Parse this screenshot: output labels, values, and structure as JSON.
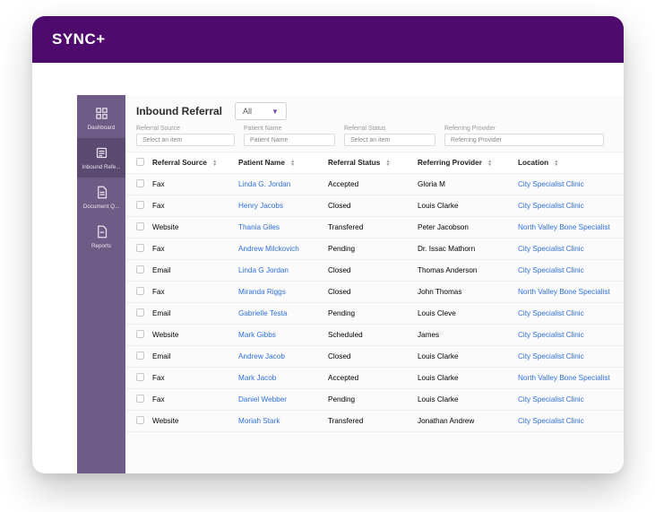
{
  "brand": "SYNC+",
  "sidebar": {
    "items": [
      {
        "label": "Dashboard",
        "icon": "grid",
        "active": false
      },
      {
        "label": "Inbound Refe...",
        "icon": "list",
        "active": true
      },
      {
        "label": "Document Q...",
        "icon": "doc-lines",
        "active": false
      },
      {
        "label": "Reports",
        "icon": "doc",
        "active": false
      }
    ]
  },
  "page": {
    "title": "Inbound Referral",
    "filterSelect": "All"
  },
  "filters": [
    {
      "label": "Referral Source",
      "placeholder": "Select an item"
    },
    {
      "label": "Patient Name",
      "placeholder": "Patient Name"
    },
    {
      "label": "Referral Status",
      "placeholder": "Select an item"
    },
    {
      "label": "Referring Provider",
      "placeholder": "Referring Provider"
    }
  ],
  "columns": [
    "Referral Source",
    "Patient Name",
    "Referral Status",
    "Referring Provider",
    "Location"
  ],
  "rows": [
    {
      "source": "Fax",
      "name": "Linda G. Jordan",
      "status": "Accepted",
      "provider": "Gloria M",
      "location": "City Specialist Clinic"
    },
    {
      "source": "Fax",
      "name": "Henry Jacobs",
      "status": "Closed",
      "provider": "Louis Clarke",
      "location": "City Specialist Clinic"
    },
    {
      "source": "Website",
      "name": "Thania Giles",
      "status": "Transfered",
      "provider": "Peter Jacobson",
      "location": "North Valley Bone Specialist"
    },
    {
      "source": "Fax",
      "name": "Andrew Milckovich",
      "status": "Pending",
      "provider": "Dr. Issac Mathorn",
      "location": "City Specialist Clinic"
    },
    {
      "source": "Email",
      "name": "Linda G Jordan",
      "status": "Closed",
      "provider": "Thomas Anderson",
      "location": "City Specialist Clinic"
    },
    {
      "source": "Fax",
      "name": "Miranda Riggs",
      "status": "Closed",
      "provider": "John Thomas",
      "location": "North Valley Bone Specialist"
    },
    {
      "source": "Email",
      "name": "Gabrielle Testa",
      "status": "Pending",
      "provider": "Louis Cleve",
      "location": "City Specialist Clinic"
    },
    {
      "source": "Website",
      "name": "Mark Gibbs",
      "status": "Scheduled",
      "provider": "James",
      "location": "City Specialist Clinic"
    },
    {
      "source": "Email",
      "name": "Andrew Jacob",
      "status": "Closed",
      "provider": "Louis Clarke",
      "location": "City Specialist Clinic"
    },
    {
      "source": "Fax",
      "name": "Mark Jacob",
      "status": "Accepted",
      "provider": "Louis Clarke",
      "location": "North Valley Bone Specialist"
    },
    {
      "source": "Fax",
      "name": "Daniel Webber",
      "status": "Pending",
      "provider": "Louis Clarke",
      "location": "City Specialist Clinic"
    },
    {
      "source": "Website",
      "name": "Moriah Stark",
      "status": "Transfered",
      "provider": "Jonathan Andrew",
      "location": "City Specialist Clinic"
    }
  ]
}
